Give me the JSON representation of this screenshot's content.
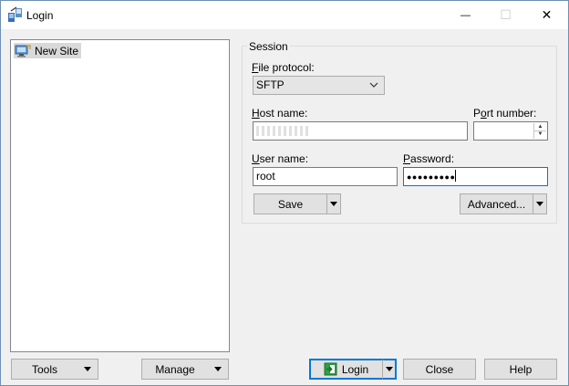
{
  "window": {
    "title": "Login",
    "controls": {
      "minimize": "—",
      "maximize": "☐",
      "close": "✕"
    }
  },
  "sites": {
    "items": [
      {
        "label": "New Site",
        "icon": "monitor-icon",
        "selected": true
      }
    ]
  },
  "session": {
    "group_label": "Session",
    "file_protocol": {
      "label_prefix": "",
      "label_accel": "F",
      "label_rest": "ile protocol:",
      "value": "SFTP"
    },
    "host_name": {
      "label_accel": "H",
      "label_rest": "ost name:"
    },
    "port_number": {
      "label_prefix": "P",
      "label_accel": "o",
      "label_rest": "rt number:"
    },
    "user_name": {
      "label_accel": "U",
      "label_rest": "ser name:",
      "value": "root"
    },
    "password": {
      "label_accel": "P",
      "label_rest": "assword:",
      "value": "●●●●●●●●●"
    },
    "save_label": "Save",
    "advanced_label": "Advanced..."
  },
  "footer": {
    "tools_label": "Tools",
    "manage_label": "Manage",
    "login_label": "Login",
    "close_label": "Close",
    "help_label": "Help"
  },
  "colors": {
    "accent": "#0078d7",
    "login_icon": "#2ea043"
  }
}
